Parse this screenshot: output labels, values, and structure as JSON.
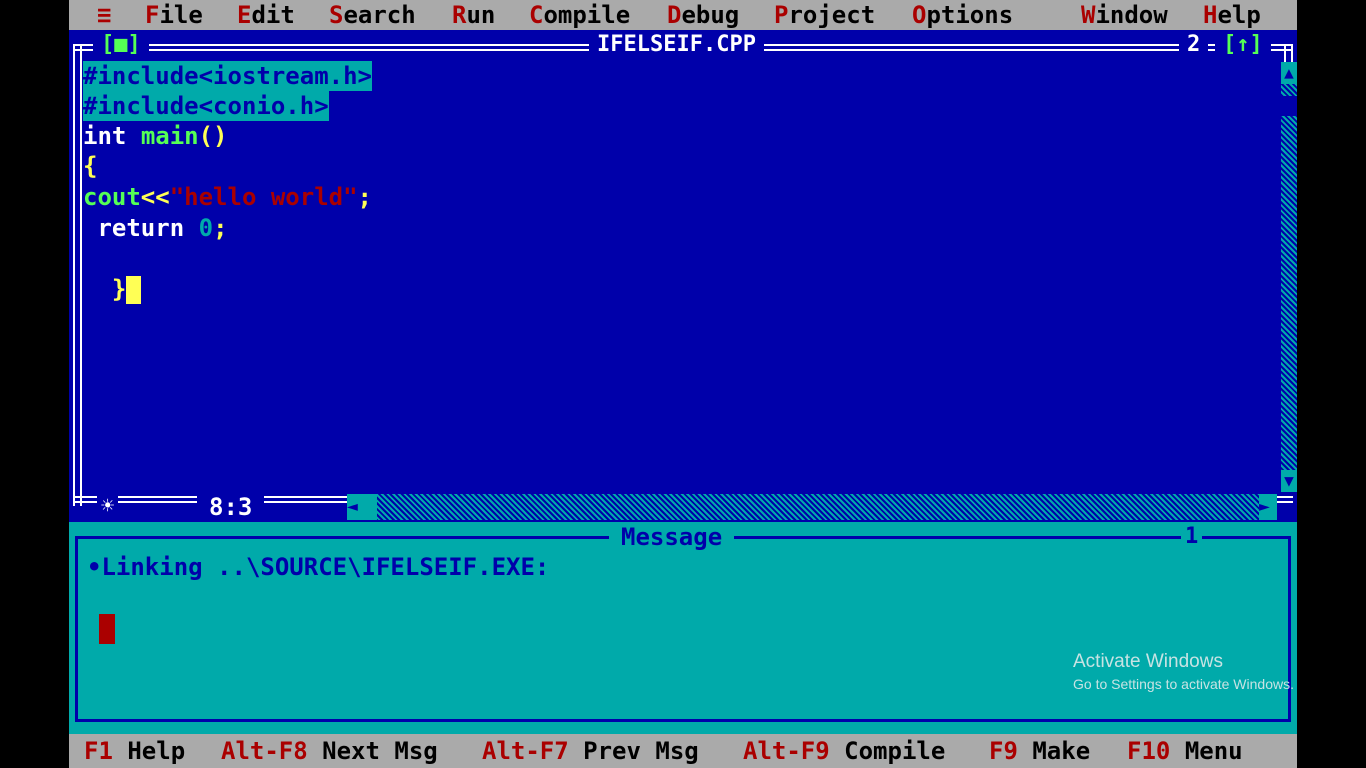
{
  "menu": {
    "system": "≡",
    "items": [
      {
        "hot": "F",
        "rest": "ile"
      },
      {
        "hot": "E",
        "rest": "dit"
      },
      {
        "hot": "S",
        "rest": "earch"
      },
      {
        "hot": "R",
        "rest": "un"
      },
      {
        "hot": "C",
        "rest": "ompile"
      },
      {
        "hot": "D",
        "rest": "ebug"
      },
      {
        "hot": "P",
        "rest": "roject"
      },
      {
        "hot": "O",
        "rest": "ptions"
      },
      {
        "hot": "W",
        "rest": "indow"
      },
      {
        "hot": "H",
        "rest": "elp"
      }
    ]
  },
  "editor": {
    "close_box": "[■]",
    "title": "IFELSEIF.CPP",
    "window_number": "2",
    "zoom_box": "[↑]",
    "code": {
      "line1": "#include<iostream.h>",
      "line2": "#include<conio.h>",
      "line3_kw": "int",
      "line3_fn": "main",
      "line3_punc": "()",
      "line4": "{",
      "line5_id": "cout",
      "line5_op": "<<",
      "line5_str": "\"hello world\"",
      "line5_end": ";",
      "line6_kw": "return",
      "line6_num": "0",
      "line6_end": ";",
      "line8": "}"
    },
    "status": {
      "modified_marker": "☀",
      "position": "8:3"
    },
    "scroll": {
      "up": "▲",
      "down": "▼",
      "left": "◄",
      "right": "►"
    }
  },
  "message": {
    "title": "Message",
    "window_number": "1",
    "text": "•Linking ..\\SOURCE\\IFELSEIF.EXE:"
  },
  "watermark": {
    "title": "Activate Windows",
    "subtitle": "Go to Settings to activate Windows."
  },
  "hints": [
    {
      "key": "F1",
      "label": "Help"
    },
    {
      "key": "Alt-F8",
      "label": "Next Msg"
    },
    {
      "key": "Alt-F7",
      "label": "Prev Msg"
    },
    {
      "key": "Alt-F9",
      "label": "Compile"
    },
    {
      "key": "F9",
      "label": "Make"
    },
    {
      "key": "F10",
      "label": "Menu"
    }
  ],
  "colors": {
    "editor_bg": "#0000aa",
    "message_bg": "#00aaaa",
    "menu_bg": "#aaaaaa",
    "hotkey": "#aa0000",
    "keyword": "#ffffff",
    "identifier": "#55ff55",
    "string": "#aa0000",
    "punctuation": "#ffff55"
  }
}
